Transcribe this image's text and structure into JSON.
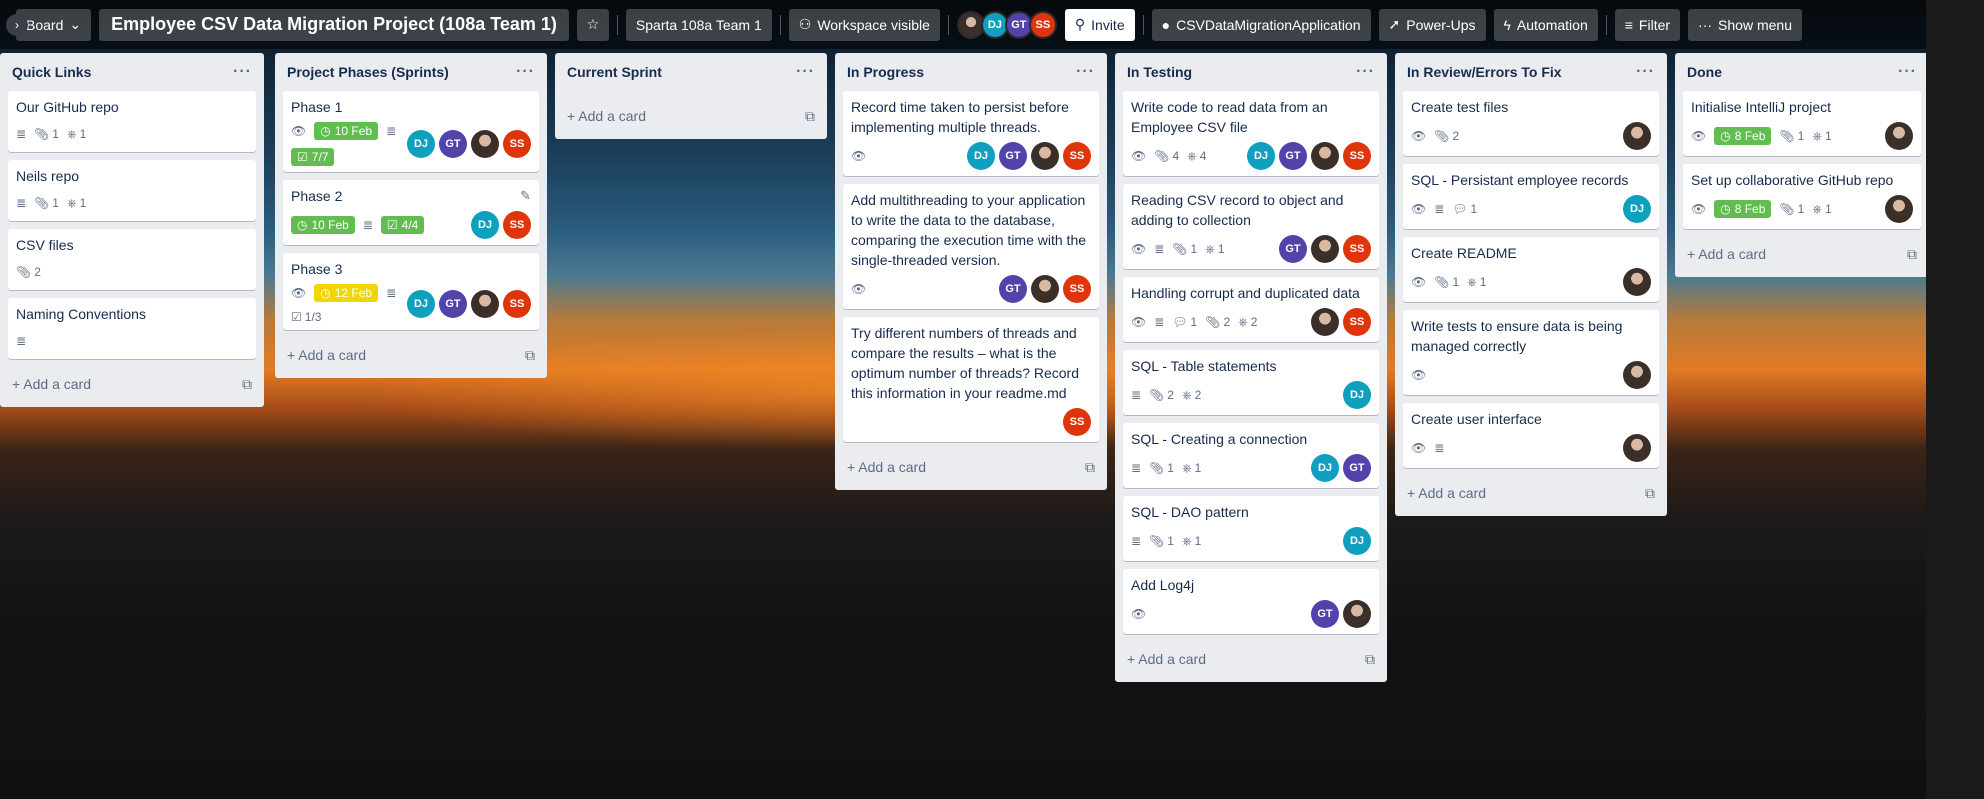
{
  "header": {
    "board_switch": "Board",
    "title": "Employee CSV Data Migration Project (108a Team 1)",
    "workspace": "Sparta 108a Team 1",
    "visibility": "Workspace visible",
    "invite": "Invite",
    "github": "CSVDataMigrationApplication",
    "powerups": "Power-Ups",
    "automation": "Automation",
    "filter": "Filter",
    "show_menu": "Show menu",
    "members": [
      "DJ",
      "GT",
      "SS"
    ]
  },
  "colors": {
    "DJ": "#0f9fbf",
    "GT": "#5243aa",
    "SS": "#de350b",
    "green": "#61bd4f",
    "yellow": "#f2d600"
  },
  "add_card": "Add a card",
  "lists": [
    {
      "title": "Quick Links",
      "cards": [
        {
          "title": "Our GitHub repo",
          "attach": "1",
          "github": "1"
        },
        {
          "title": "Neils repo",
          "attach": "1",
          "github": "1"
        },
        {
          "title": "CSV files",
          "attach": "2"
        },
        {
          "title": "Naming Conventions"
        }
      ]
    },
    {
      "title": "Project Phases (Sprints)",
      "cards": [
        {
          "title": "Phase 1",
          "date": "10 Feb",
          "check": "7/7"
        },
        {
          "title": "Phase 2",
          "date": "10 Feb",
          "check": "4/4"
        },
        {
          "title": "Phase 3",
          "date": "12 Feb",
          "check": "1/3"
        }
      ]
    },
    {
      "title": "Current Sprint",
      "cards": []
    },
    {
      "title": "In Progress",
      "cards": [
        {
          "title": "Record time taken to persist before implementing multiple threads."
        },
        {
          "title": "Add multithreading to your application to write the data to the database, comparing the execution time with the single-threaded version."
        },
        {
          "title": "Try different numbers of threads and compare the results – what is the optimum number of threads? Record this information in your readme.md"
        }
      ]
    },
    {
      "title": "In Testing",
      "cards": [
        {
          "title": "Write code to read data from an Employee CSV file",
          "attach": "4",
          "github": "4"
        },
        {
          "title": "Reading CSV record to object and adding to collection",
          "attach": "1",
          "github": "1"
        },
        {
          "title": "Handling corrupt and duplicated data",
          "comments": "1",
          "attach": "2",
          "github": "2"
        },
        {
          "title": "SQL - Table statements",
          "attach": "2",
          "github": "2"
        },
        {
          "title": "SQL - Creating a connection",
          "attach": "1",
          "github": "1"
        },
        {
          "title": "SQL - DAO pattern",
          "attach": "1",
          "github": "1"
        },
        {
          "title": "Add Log4j"
        }
      ]
    },
    {
      "title": "In Review/Errors To Fix",
      "cards": [
        {
          "title": "Create test files",
          "attach": "2"
        },
        {
          "title": "SQL - Persistant employee records",
          "comments": "1"
        },
        {
          "title": "Create README",
          "attach": "1",
          "github": "1"
        },
        {
          "title": "Write tests to ensure data is being managed correctly"
        },
        {
          "title": "Create user interface"
        }
      ]
    },
    {
      "title": "Done",
      "cards": [
        {
          "title": "Initialise IntelliJ project",
          "date": "8 Feb",
          "attach": "1",
          "github": "1"
        },
        {
          "title": "Set up collaborative GitHub repo",
          "date": "8 Feb",
          "attach": "1",
          "github": "1"
        }
      ]
    }
  ]
}
